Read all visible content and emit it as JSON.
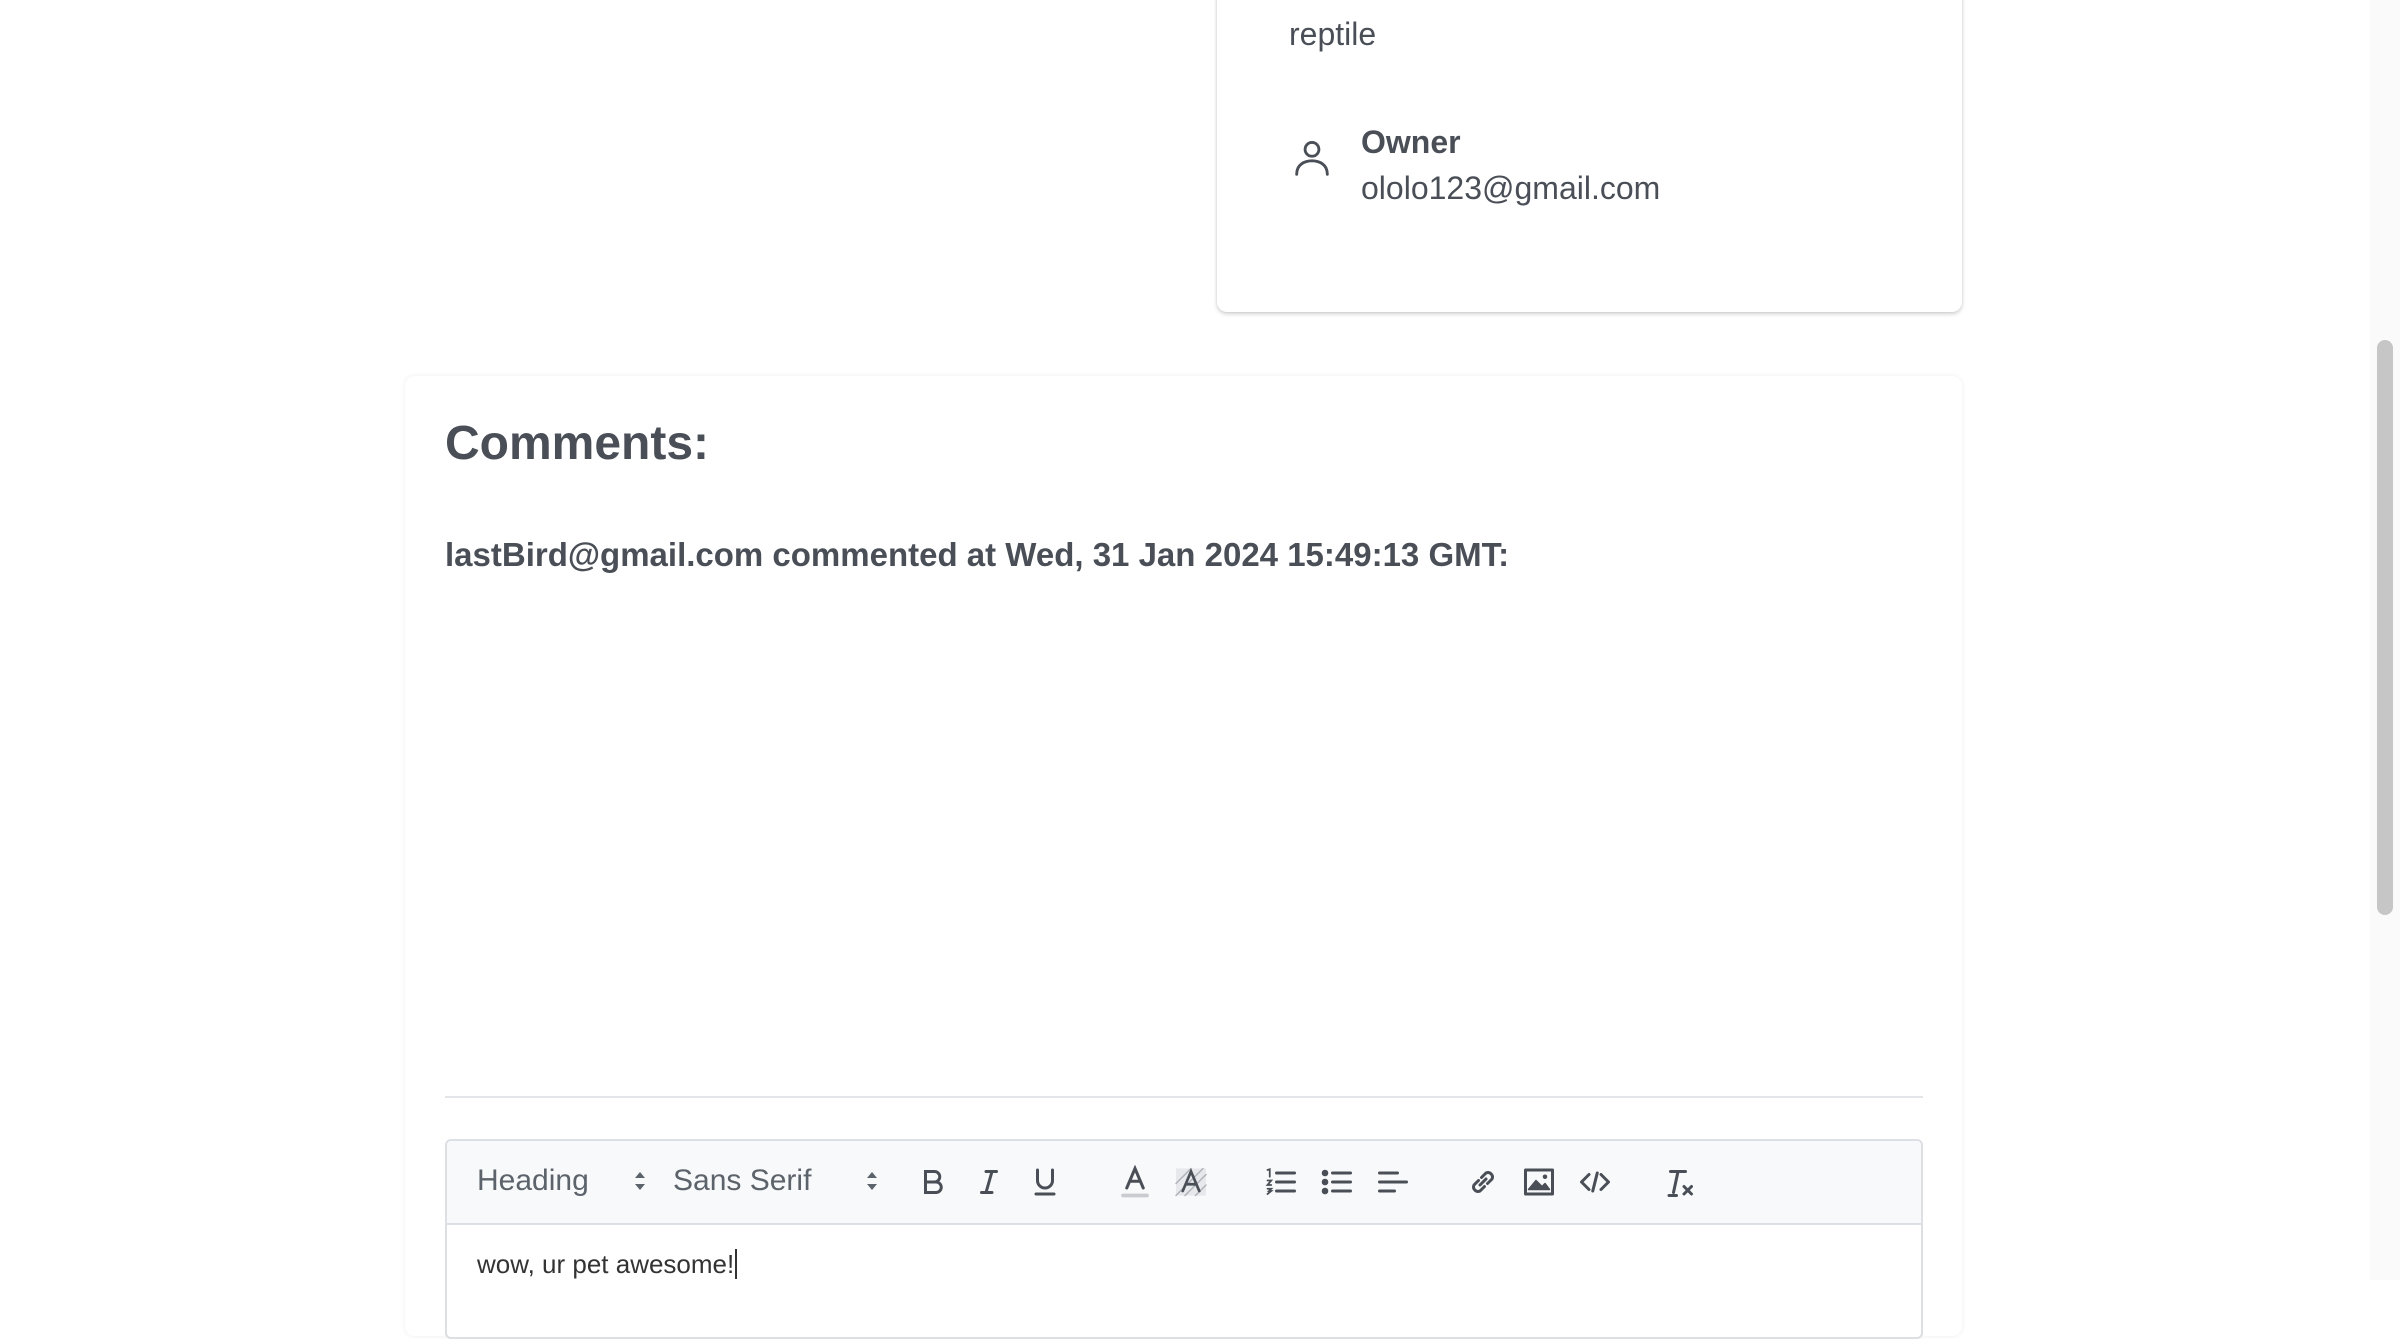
{
  "pet_info": {
    "species_value": "reptile",
    "owner_label": "Owner",
    "owner_email": "ololo123@gmail.com"
  },
  "comments": {
    "title": "Comments:",
    "items": [
      {
        "header": "lastBird@gmail.com commented at Wed, 31 Jan 2024 15:49:13 GMT:"
      }
    ]
  },
  "editor": {
    "heading_picker": "Heading",
    "font_picker": "Sans Serif",
    "toolbar_icons": [
      "bold-icon",
      "italic-icon",
      "underline-icon",
      "text-color-icon",
      "background-color-icon",
      "ordered-list-icon",
      "bullet-list-icon",
      "align-icon",
      "link-icon",
      "image-icon",
      "code-icon",
      "clear-format-icon"
    ],
    "content": "wow, ur pet awesome!"
  }
}
